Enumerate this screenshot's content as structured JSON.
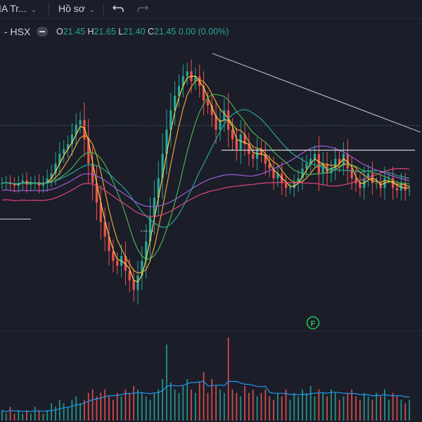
{
  "toolbar": {
    "indicator_label": "IA Tr...",
    "profile_label": "Hồ sơ",
    "undo_icon": "undo-icon",
    "redo_icon": "redo-icon"
  },
  "legend": {
    "symbol": "- HSX",
    "o_label": "O",
    "o_value": "21.45",
    "h_label": "H",
    "h_value": "21.65",
    "l_label": "L",
    "l_value": "21.40",
    "c_label": "C",
    "c_value": "21.45",
    "change": "0.00 (0.00%)"
  },
  "marker": "F",
  "colors": {
    "up": "#26a69a",
    "down": "#ef5350",
    "ma_fast": "#f5d142",
    "ma_mid": "#e8a33b",
    "ma_slow1": "#4caf50",
    "ma_slow2": "#26a69a",
    "ma_long1": "#9c5fd6",
    "ma_long2": "#e0457b",
    "trendline": "#b2b5be",
    "volume_ma": "#2196f3"
  },
  "chart_data": {
    "type": "candlestick",
    "title": "",
    "xlabel": "",
    "ylabel": "",
    "ylim": [
      19.0,
      24.5
    ],
    "last_price": 21.45,
    "closes": [
      21.6,
      21.62,
      21.58,
      21.55,
      21.6,
      21.65,
      21.57,
      21.6,
      21.62,
      21.55,
      21.6,
      21.7,
      21.8,
      22.0,
      22.2,
      22.3,
      22.4,
      22.6,
      22.8,
      22.9,
      22.5,
      22.0,
      21.6,
      21.2,
      20.8,
      20.5,
      20.2,
      20.0,
      19.9,
      20.1,
      19.8,
      19.6,
      19.4,
      19.7,
      20.0,
      20.4,
      20.9,
      21.3,
      21.7,
      22.2,
      22.7,
      23.1,
      23.4,
      23.6,
      23.8,
      23.9,
      23.7,
      23.8,
      23.6,
      23.3,
      23.2,
      23.0,
      22.7,
      22.9,
      23.1,
      22.7,
      22.5,
      22.3,
      22.6,
      22.4,
      22.2,
      22.1,
      22.3,
      22.2,
      22.0,
      21.9,
      21.7,
      21.8,
      21.6,
      21.5,
      21.5,
      21.6,
      21.7,
      21.9,
      22.0,
      22.1,
      22.2,
      21.8,
      22.0,
      21.8,
      21.9,
      22.1,
      22.0,
      22.2,
      21.9,
      21.7,
      21.6,
      21.5,
      21.7,
      21.8,
      21.6,
      21.6,
      21.5,
      21.7,
      21.7,
      21.5,
      21.45,
      21.6,
      21.45,
      21.45
    ],
    "volumes": [
      3,
      2,
      4,
      2,
      3,
      2,
      3,
      2,
      4,
      3,
      2,
      3,
      5,
      4,
      6,
      5,
      4,
      6,
      7,
      5,
      6,
      8,
      9,
      7,
      8,
      9,
      7,
      6,
      8,
      7,
      9,
      8,
      10,
      9,
      8,
      7,
      6,
      8,
      9,
      12,
      22,
      11,
      9,
      8,
      10,
      12,
      9,
      8,
      11,
      14,
      8,
      12,
      10,
      9,
      8,
      24,
      9,
      8,
      7,
      10,
      8,
      9,
      7,
      8,
      9,
      7,
      6,
      8,
      7,
      9,
      6,
      8,
      7,
      9,
      8,
      10,
      7,
      9,
      8,
      7,
      9,
      8,
      6,
      7,
      8,
      9,
      7,
      6,
      8,
      7,
      6,
      8,
      7,
      9,
      6,
      8,
      7,
      6,
      5,
      6
    ]
  }
}
